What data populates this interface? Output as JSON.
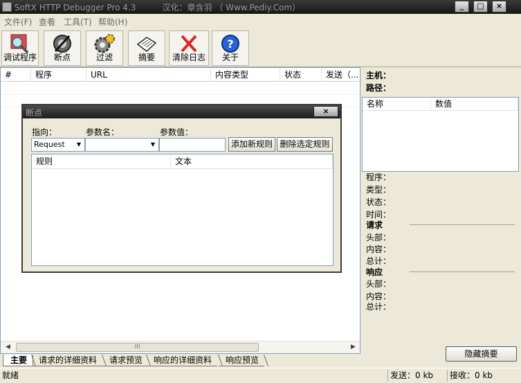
{
  "window": {
    "title": "SoftX HTTP Debugger Pro 4.3          汉化：章含羽 （ Www.Pediy.Com）",
    "minimize": "_",
    "maximize": "□",
    "close": "×"
  },
  "menu": [
    "文件(F)",
    "查看",
    "工具(T)",
    "帮助(H)"
  ],
  "toolbar": [
    {
      "label": "调试程序",
      "icon": "debug-program-icon"
    },
    {
      "label": "断点",
      "icon": "breakpoint-icon"
    },
    {
      "label": "过滤",
      "icon": "filter-gear-icon"
    },
    {
      "label": "摘要",
      "icon": "summary-book-icon"
    },
    {
      "label": "清除日志",
      "icon": "clear-log-x-icon"
    },
    {
      "label": "关于",
      "icon": "about-question-icon"
    }
  ],
  "main_list": {
    "columns": [
      "#",
      "程序",
      "URL",
      "内容类型",
      "状态",
      "发送（..."
    ],
    "rows": []
  },
  "scrollbar": {
    "left": "◀",
    "right": "▶",
    "grip": "III"
  },
  "right_panel": {
    "host_label": "主机：",
    "path_label": "路径：",
    "nv_columns": [
      "名称",
      "数值"
    ],
    "program_label": "程序：",
    "type_label": "类型：",
    "status_label": "状态：",
    "time_label": "时间：",
    "request_heading": "请求",
    "req_header_label": "头部：",
    "req_content_label": "内容：",
    "req_total_label": "总计：",
    "response_heading": "响应",
    "resp_header_label": "头部：",
    "resp_content_label": "内容：",
    "resp_total_label": "总计：",
    "hide_summary_button": "隐藏摘要"
  },
  "tabs": [
    "主要",
    "请求的详细资料",
    "请求预览",
    "响应的详细资料",
    "响应预览"
  ],
  "statusbar": {
    "ready": "就绪",
    "sent": "发送：0 kb",
    "received": "接收：0 kb"
  },
  "breakpoint_dialog": {
    "title": "断点",
    "close": "×",
    "direction_label": "指向：",
    "direction_value": "Request",
    "param_name_label": "参数名：",
    "param_name_value": "",
    "param_value_label": "参数值：",
    "param_value_value": "",
    "add_rule_button": "添加新规则",
    "delete_rule_button": "删除选定规则",
    "rules_columns": [
      "规则",
      "文本"
    ],
    "rules": []
  }
}
